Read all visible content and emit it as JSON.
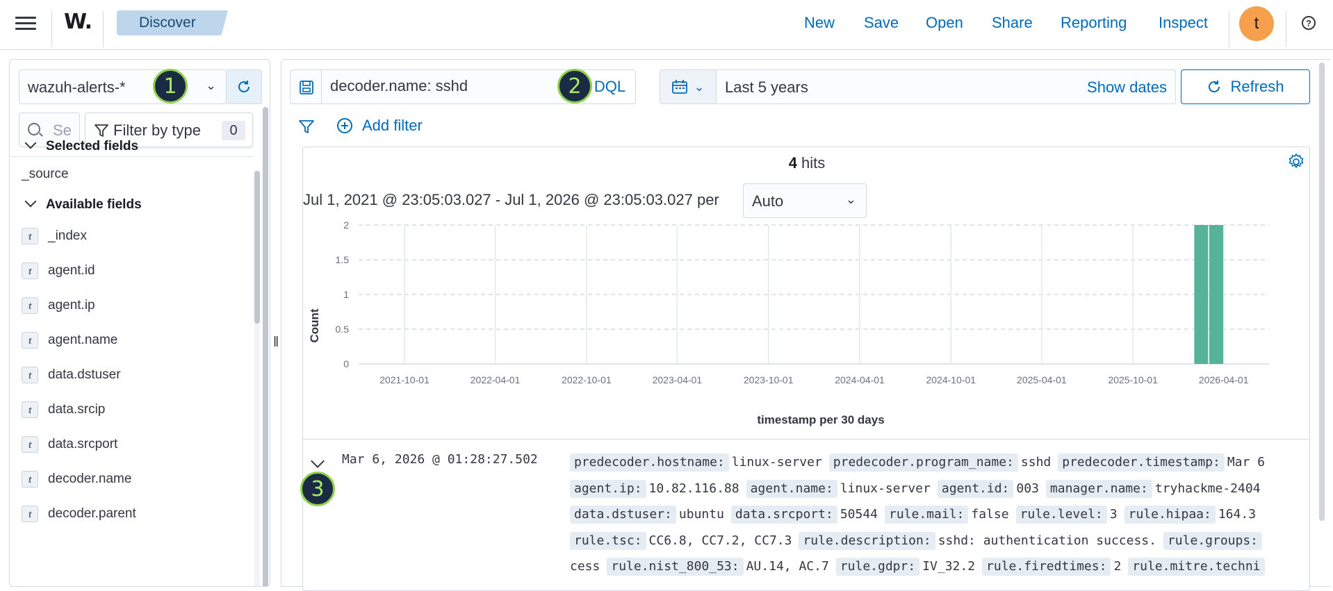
{
  "topbar": {
    "app_logo": "W.",
    "breadcrumb": "Discover",
    "nav": [
      "New",
      "Save",
      "Open",
      "Share",
      "Reporting",
      "Inspect"
    ],
    "avatar_initial": "t",
    "help_glyph": "?"
  },
  "sidebar": {
    "index_pattern": "wazuh-alerts-*",
    "search_placeholder": "Se",
    "filter_by_type_label": "Filter by type",
    "filter_count": "0",
    "selected_fields_title": "Selected fields",
    "selected_fields": [
      {
        "name": "_source",
        "type": "</>"
      }
    ],
    "available_fields_title": "Available fields",
    "available_fields": [
      {
        "name": "_index",
        "type": "t"
      },
      {
        "name": "agent.id",
        "type": "t"
      },
      {
        "name": "agent.ip",
        "type": "t"
      },
      {
        "name": "agent.name",
        "type": "t"
      },
      {
        "name": "data.dstuser",
        "type": "t"
      },
      {
        "name": "data.srcip",
        "type": "t"
      },
      {
        "name": "data.srcport",
        "type": "t"
      },
      {
        "name": "decoder.name",
        "type": "t"
      },
      {
        "name": "decoder.parent",
        "type": "t"
      }
    ]
  },
  "query_bar": {
    "query": "decoder.name: sshd",
    "language": "DQL",
    "date_range": "Last 5 years",
    "show_dates_label": "Show dates",
    "refresh_label": "Refresh",
    "add_filter_label": "Add filter"
  },
  "histogram": {
    "hits_count": "4",
    "hits_label": " hits",
    "range_text": "Jul 1, 2021 @ 23:05:03.027 - Jul 1, 2026 @ 23:05:03.027 per",
    "interval": "Auto"
  },
  "chart_data": {
    "type": "bar",
    "xlabel": "timestamp per 30 days",
    "ylabel": "Count",
    "ylim": [
      0,
      2
    ],
    "y_ticks": [
      "0",
      "0.5",
      "1",
      "1.5",
      "2"
    ],
    "x_ticks": [
      "2021-10-01",
      "2022-04-01",
      "2022-10-01",
      "2023-04-01",
      "2023-10-01",
      "2024-04-01",
      "2024-10-01",
      "2025-04-01",
      "2025-10-01",
      "2026-04-01"
    ],
    "x_range": [
      "2021-07-01",
      "2026-07-01"
    ],
    "grid": true,
    "bar_color": "#54b399",
    "bars": [
      {
        "start": "2026-02-01",
        "end": "2026-03-03",
        "value": 2
      },
      {
        "start": "2026-03-03",
        "end": "2026-04-02",
        "value": 2
      }
    ]
  },
  "document": {
    "timestamp": "Mar 6, 2026 @ 01:28:27.502",
    "lines": [
      [
        [
          "predecoder.hostname:",
          "linux-server"
        ],
        [
          "predecoder.program_name:",
          "sshd"
        ],
        [
          "predecoder.timestamp:",
          "Mar 6"
        ]
      ],
      [
        [
          "agent.ip:",
          "10.82.116.88"
        ],
        [
          "agent.name:",
          "linux-server"
        ],
        [
          "agent.id:",
          "003"
        ],
        [
          "manager.name:",
          "tryhackme-2404"
        ]
      ],
      [
        [
          "data.dstuser:",
          "ubuntu"
        ],
        [
          "data.srcport:",
          "50544"
        ],
        [
          "rule.mail:",
          "false"
        ],
        [
          "rule.level:",
          "3"
        ],
        [
          "rule.hipaa:",
          "164.3"
        ]
      ],
      [
        [
          "rule.tsc:",
          "CC6.8, CC7.2, CC7.3"
        ],
        [
          "rule.description:",
          "sshd: authentication success."
        ],
        [
          "rule.groups:",
          ""
        ]
      ],
      [
        [
          "",
          "cess"
        ],
        [
          "rule.nist_800_53:",
          "AU.14, AC.7"
        ],
        [
          "rule.gdpr:",
          "IV_32.2"
        ],
        [
          "rule.firedtimes:",
          "2"
        ],
        [
          "rule.mitre.techni",
          ""
        ]
      ]
    ]
  },
  "markers": [
    "1",
    "2",
    "3"
  ]
}
